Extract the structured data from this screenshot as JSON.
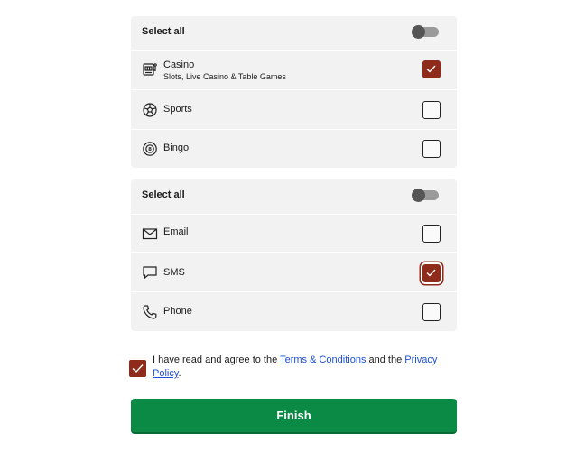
{
  "group_1": {
    "select_all_label": "Select all",
    "items": [
      {
        "label": "Casino",
        "sublabel": "Slots, Live Casino & Table Games",
        "icon": "slot-machine-icon",
        "checked": true
      },
      {
        "label": "Sports",
        "icon": "football-icon",
        "checked": false
      },
      {
        "label": "Bingo",
        "icon": "bingo-ball-icon",
        "checked": false
      }
    ]
  },
  "group_2": {
    "select_all_label": "Select all",
    "items": [
      {
        "label": "Email",
        "icon": "envelope-icon",
        "checked": false
      },
      {
        "label": "SMS",
        "icon": "chat-bubble-icon",
        "checked": true
      },
      {
        "label": "Phone",
        "icon": "phone-icon",
        "checked": false
      }
    ]
  },
  "terms": {
    "checked": true,
    "prefix": "I have read and agree to the ",
    "terms_link": "Terms & Conditions",
    "middle": " and the ",
    "privacy_link_line1": "Privacy",
    "privacy_link_line2": "Policy",
    "suffix": "."
  },
  "finish_label": "Finish",
  "colors": {
    "check_red": "#8e2b1a",
    "finish_green": "#0a8a44",
    "link_blue": "#1d4fd6",
    "panel_bg": "#f2f2f2"
  }
}
